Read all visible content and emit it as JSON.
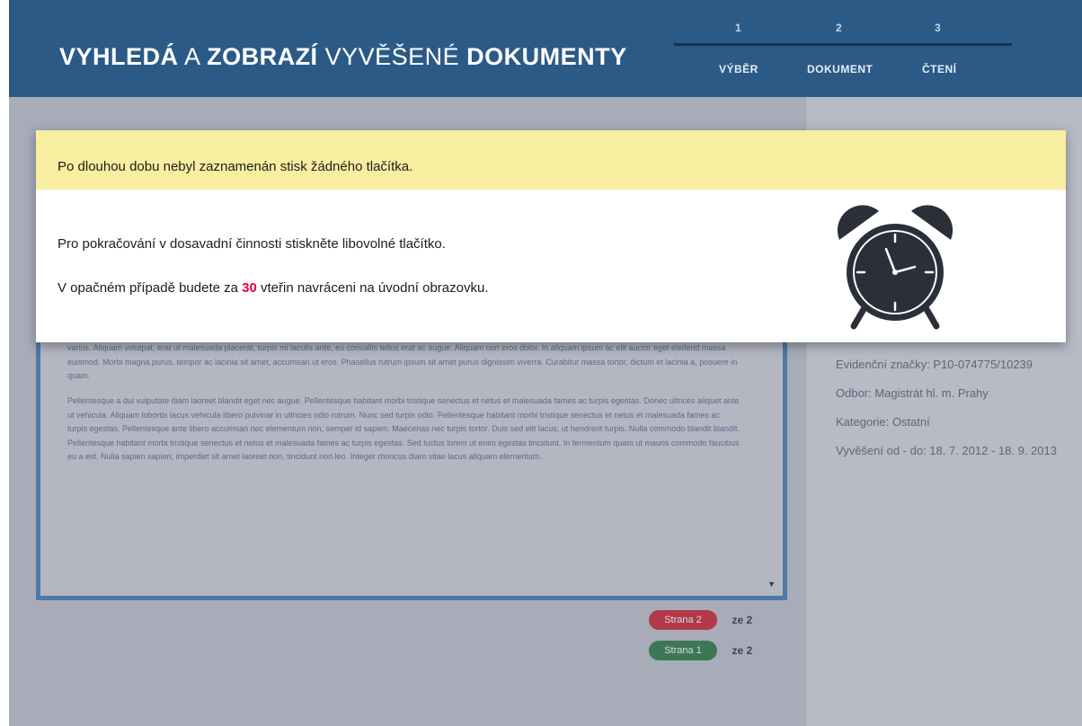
{
  "header": {
    "title_part1": "VYHLEDÁ",
    "title_part2": "A",
    "title_part3": "ZOBRAZÍ",
    "title_part4": "VYVĚŠENÉ",
    "title_part5": "DOKUMENTY",
    "steps": [
      {
        "number": "1",
        "label": "VÝBĚR"
      },
      {
        "number": "2",
        "label": "DOKUMENT"
      },
      {
        "number": "3",
        "label": "ČTENÍ"
      }
    ]
  },
  "modal": {
    "warning": "Po dlouhou dobu nebyl zaznamenán stisk žádného tlačítka.",
    "line1": "Pro pokračování v dosavadní činnosti stiskněte libovolné tlačítko.",
    "line2_before": "V opačném případě budete za",
    "countdown": "30",
    "line2_after": "vteřin navráceni na úvodní obrazovku.",
    "icon": "alarm-clock-icon",
    "accent_color": "#e4003c"
  },
  "document": {
    "paragraph1": "consectetur quis. In eros ante, condimentum sed convallis quis, condimentum eu purus. Nullam quis odio id velit viverra dignissim. Proin volutpat adipiscing massa, in bibendum ante aliquet nec. Proin nisl metus, condimentum sit amet convallis in, fermentum id nibh. Ut in neque vitae tellus laoreet malesuada. Nunc luctus velit eleifend arcu egestas ac faucibus diam varius. Aliquam volutpat, erat ut malesuada placerat, turpis mi iaculis ante, eu convallis tellus erat ac augue. Aliquam non eros dolor. In aliquam ipsum ac elit auctor eget eleifend massa euismod. Morbi magna purus, tempor ac lacinia sit amet, accumsan ut eros. Phasellus rutrum ipsum sit amet purus dignissim viverra. Curabitur massa tortor, dictum et lacinia a, posuere in quam.",
    "paragraph2": "Pellentesque a dui vulputate diam laoreet blandit eget nec augue. Pellentesque habitant morbi tristique senectus et netus et malesuada fames ac turpis egestas. Donec ultrices aliquet ante ut vehicula. Aliquam lobortis lacus vehicula libero pulvinar in ultricies odio rutrum. Nunc sed turpis odio. Pellentesque habitant morbi tristique senectus et netus et malesuada fames ac turpis egestas. Pellentesque ante libero accumsan nec elementum non, semper id sapien. Maecenas nec turpis tortor. Duis sed elit lacus, ut hendrerit turpis. Nulla commodo blandit blandit. Pellentesque habitant morbi tristique senectus et netus et malesuada fames ac turpis egestas. Sed luctus lorem ut enim egestas tincidunt. In fermentum quam ut mauris commodo faucibus eu a est. Nulla sapien sapien, imperdiet sit amet laoreet non, tincidunt non leo. Integer rhoncus diam vitae lacus aliquam elementum."
  },
  "details": {
    "evidence": "Evidenční značky: P10-074775/10239",
    "department": "Odbor: Magistrát hl. m. Prahy",
    "category": "Kategorie: Ostatní",
    "posted": "Vyvěšení od - do: 18. 7. 2012 - 18. 9. 2013"
  },
  "pagination": {
    "next_label": "Strana 2",
    "prev_label": "Strana 1",
    "of_label": "ze 2"
  }
}
